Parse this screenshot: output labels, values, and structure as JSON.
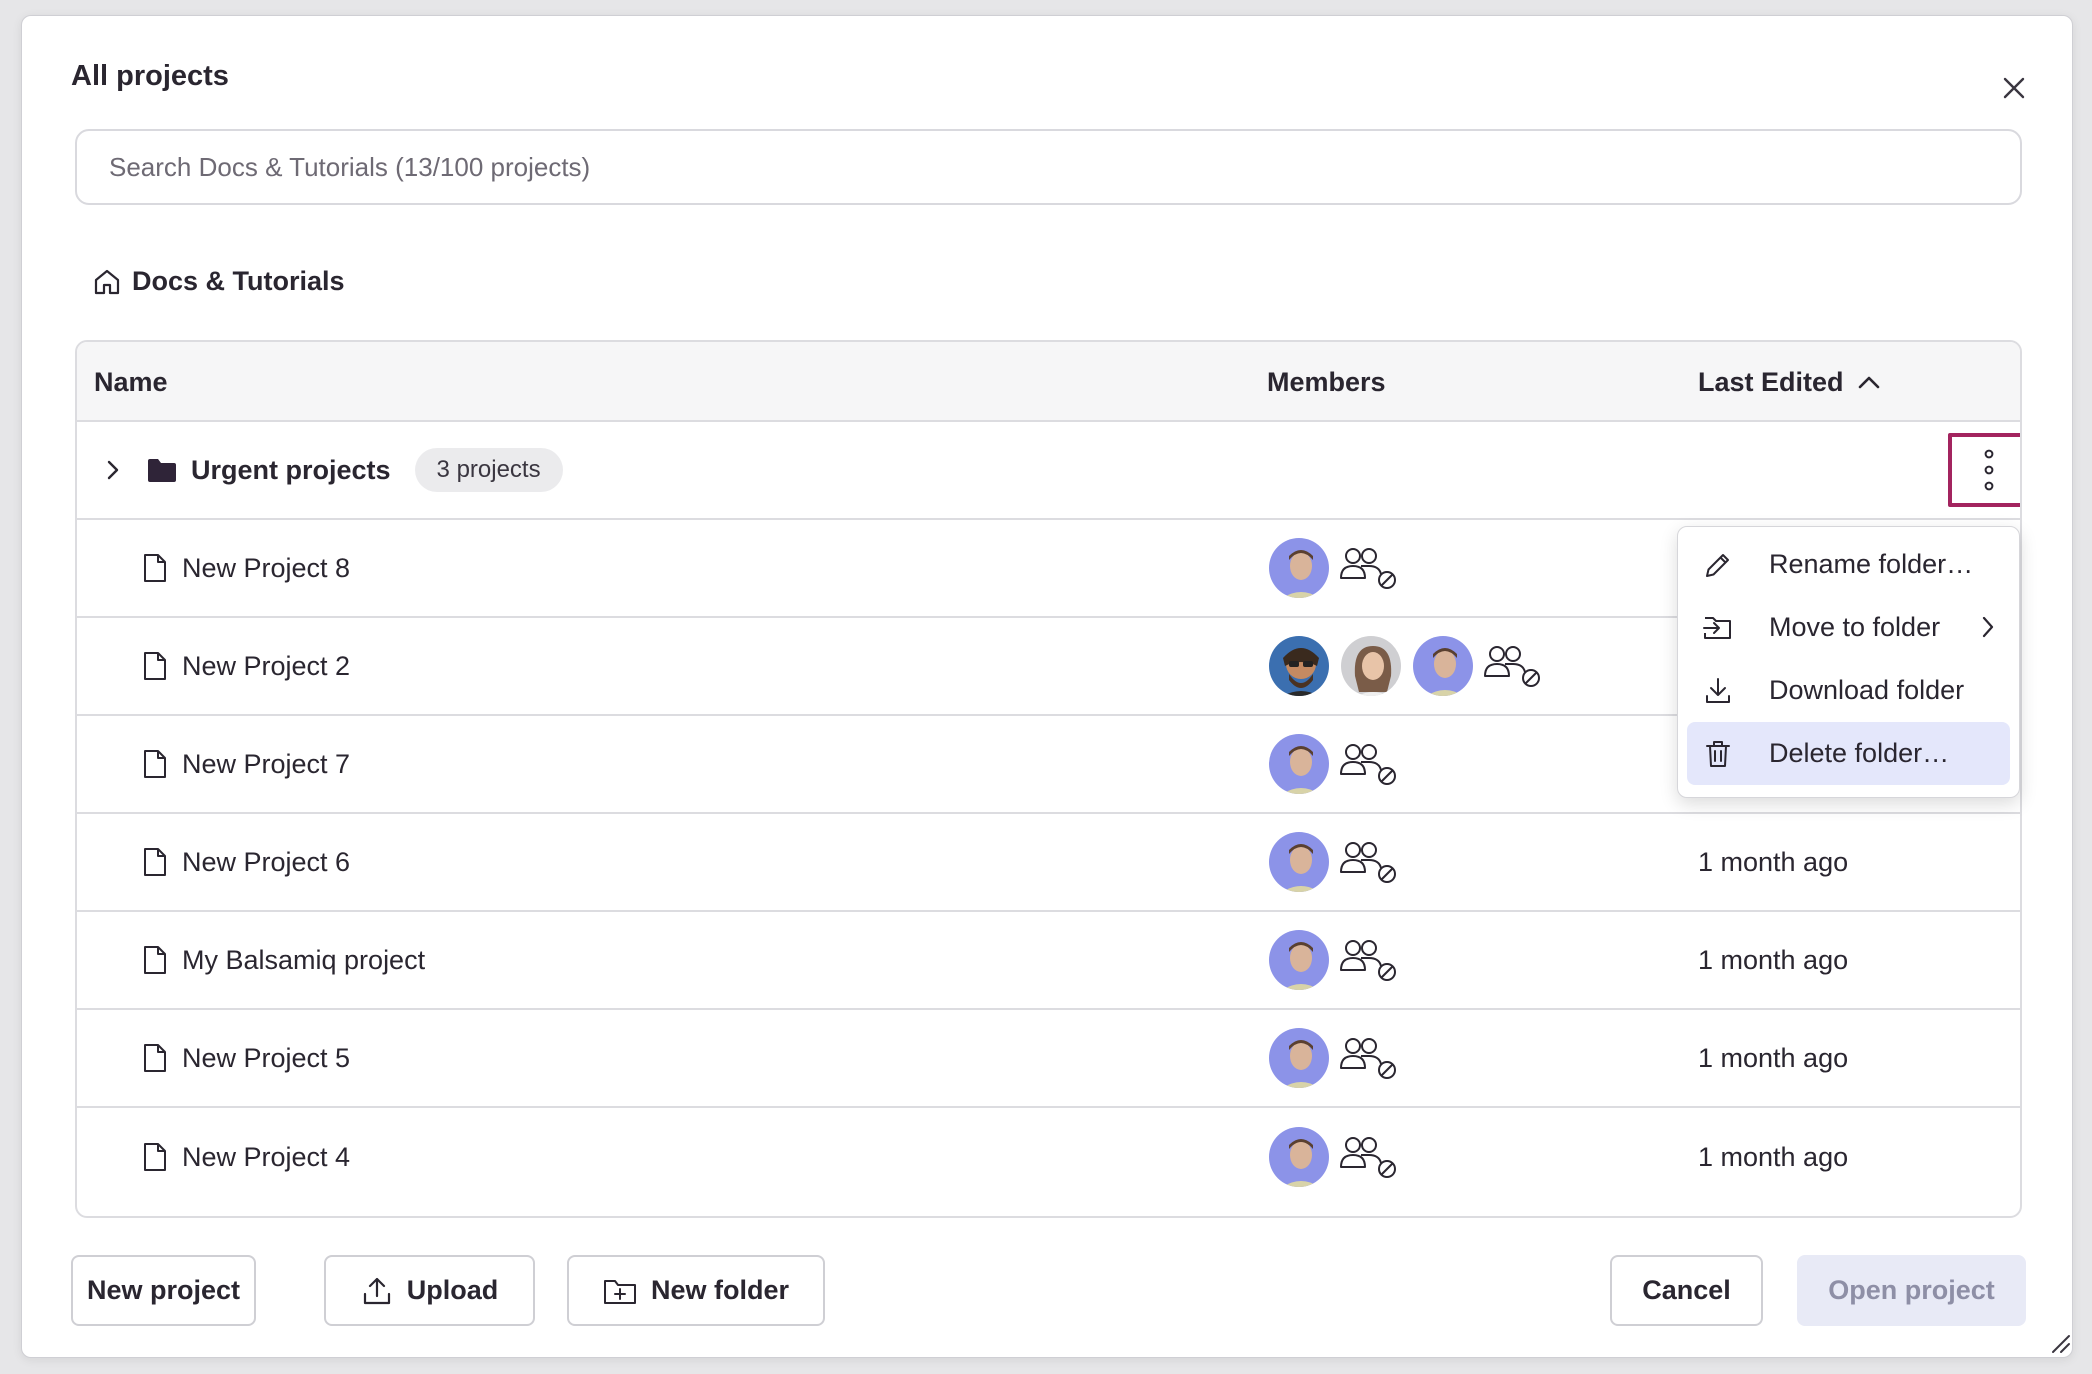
{
  "dialog": {
    "title": "All projects"
  },
  "search": {
    "placeholder": "Search Docs & Tutorials (13/100 projects)"
  },
  "breadcrumb": {
    "label": "Docs & Tutorials",
    "icon": "home-icon"
  },
  "table": {
    "headers": {
      "name": "Name",
      "members": "Members",
      "last_edited": "Last Edited"
    },
    "sort": "ascending",
    "folder": {
      "name": "Urgent projects",
      "badge": "3 projects"
    },
    "rows": [
      {
        "name": "New Project 8",
        "members": [
          "avatar-blue"
        ],
        "last_edited": ""
      },
      {
        "name": "New Project 2",
        "members": [
          "avatar-sunglasses",
          "avatar-woman",
          "avatar-blue"
        ],
        "last_edited": ""
      },
      {
        "name": "New Project 7",
        "members": [
          "avatar-blue"
        ],
        "last_edited": ""
      },
      {
        "name": "New Project 6",
        "members": [
          "avatar-blue"
        ],
        "last_edited": "1 month ago"
      },
      {
        "name": "My Balsamiq project",
        "members": [
          "avatar-blue"
        ],
        "last_edited": "1 month ago"
      },
      {
        "name": "New Project 5",
        "members": [
          "avatar-blue"
        ],
        "last_edited": "1 month ago"
      },
      {
        "name": "New Project 4",
        "members": [
          "avatar-blue"
        ],
        "last_edited": "1 month ago"
      }
    ]
  },
  "context_menu": {
    "items": [
      {
        "label": "Rename folder…",
        "icon": "pencil-icon"
      },
      {
        "label": "Move to folder",
        "icon": "move-folder-icon"
      },
      {
        "label": "Download folder",
        "icon": "download-icon"
      },
      {
        "label": "Delete folder…",
        "icon": "trash-icon"
      }
    ],
    "highlighted_index": 3
  },
  "footer": {
    "new_project": "New project",
    "upload": "Upload",
    "new_folder": "New folder",
    "cancel": "Cancel",
    "open_project": "Open project"
  },
  "colors": {
    "accent_outline": "#a3245f",
    "menu_highlight": "#e4e7fb",
    "disabled_button_bg": "#e8eaf6",
    "avatar_blue": "#8c93e8"
  }
}
